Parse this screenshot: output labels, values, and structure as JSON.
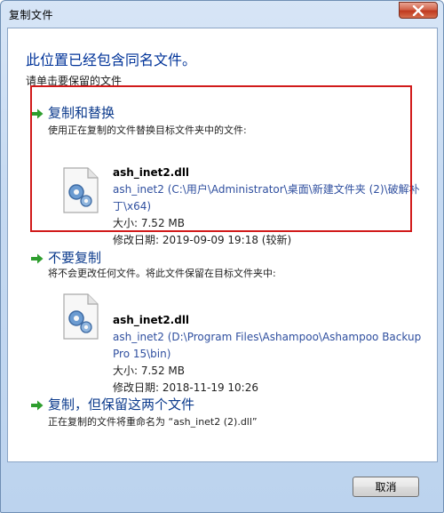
{
  "window": {
    "title": "复制文件"
  },
  "dialog": {
    "heading": "此位置已经包含同名文件。",
    "subheading": "请单击要保留的文件"
  },
  "options": {
    "replace": {
      "title": "复制和替换",
      "description": "使用正在复制的文件替换目标文件夹中的文件:",
      "file": {
        "name": "ash_inet2.dll",
        "path": "ash_inet2 (C:\\用户\\Administrator\\桌面\\新建文件夹 (2)\\破解补丁\\x64)",
        "size": "大小: 7.52 MB",
        "modified": "修改日期: 2019-09-09 19:18 (较新)"
      }
    },
    "skip": {
      "title": "不要复制",
      "description": "将不会更改任何文件。将此文件保留在目标文件夹中:",
      "file": {
        "name": "ash_inet2.dll",
        "path": "ash_inet2 (D:\\Program Files\\Ashampoo\\Ashampoo Backup Pro 15\\bin)",
        "size": "大小: 7.52 MB",
        "modified": "修改日期: 2018-11-19 10:26"
      }
    },
    "keep_both": {
      "title": "复制，但保留这两个文件",
      "description": "正在复制的文件将重命名为 “ash_inet2 (2).dll”"
    }
  },
  "buttons": {
    "cancel": "取消"
  },
  "colors": {
    "highlight_border": "#d11a1a",
    "arrow_green": "#2e9e2e",
    "link_blue": "#0b3a8c"
  }
}
